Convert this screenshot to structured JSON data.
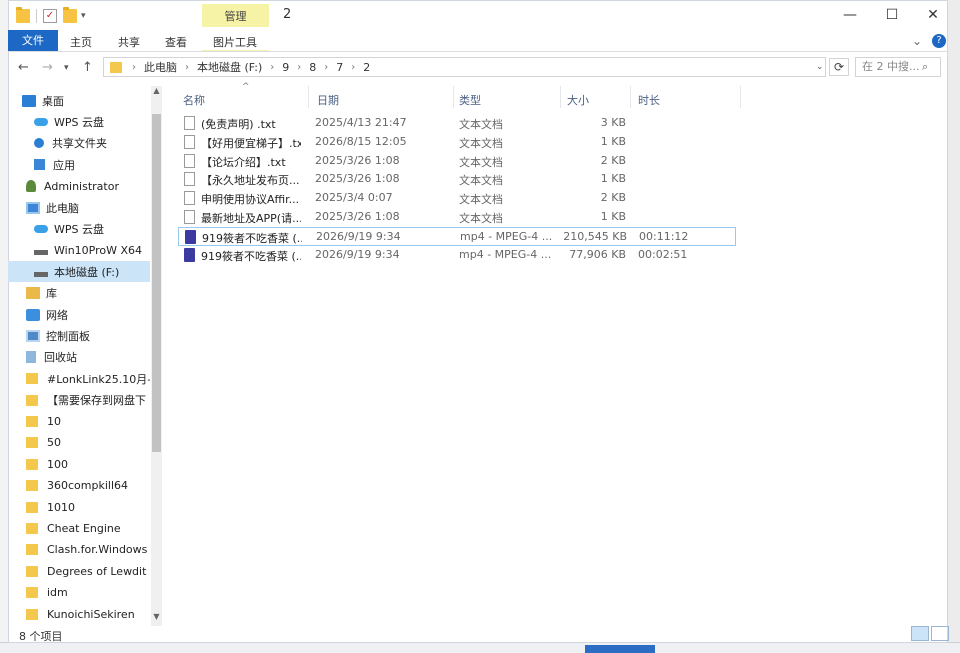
{
  "window": {
    "title": "2",
    "context_tab": "管理",
    "controls": {
      "minimize": "—",
      "maximize": "☐",
      "close": "✕"
    }
  },
  "ribbon": {
    "tabs": [
      "文件",
      "主页",
      "共享",
      "查看",
      "图片工具"
    ],
    "collapse_glyph": "⌄",
    "help_glyph": "?"
  },
  "address": {
    "crumbs": [
      "此电脑",
      "本地磁盘 (F:)",
      "9",
      "8",
      "7",
      "2"
    ],
    "search_placeholder": "在 2 中搜...",
    "refresh_glyph": "⟳"
  },
  "nav": {
    "items": [
      {
        "label": "桌面",
        "icon": "desktop-icon",
        "kind": "desk"
      },
      {
        "label": "WPS 云盘",
        "icon": "cloud-icon",
        "kind": "cloud"
      },
      {
        "label": "共享文件夹",
        "icon": "share-icon",
        "kind": "share"
      },
      {
        "label": "应用",
        "icon": "apps-icon",
        "kind": "app"
      },
      {
        "label": "Administrator",
        "icon": "user-icon",
        "kind": "user"
      },
      {
        "label": "此电脑",
        "icon": "computer-icon",
        "kind": "pc"
      },
      {
        "label": "WPS 云盘",
        "icon": "cloud-icon",
        "kind": "cloud"
      },
      {
        "label": "Win10ProW X64",
        "icon": "drive-icon",
        "kind": "drive"
      },
      {
        "label": "本地磁盘 (F:)",
        "icon": "drive-icon",
        "kind": "drive",
        "selected": true
      },
      {
        "label": "库",
        "icon": "library-icon",
        "kind": "lib"
      },
      {
        "label": "网络",
        "icon": "network-icon",
        "kind": "net"
      },
      {
        "label": "控制面板",
        "icon": "control-panel-icon",
        "kind": "ctrl"
      },
      {
        "label": "回收站",
        "icon": "recycle-bin-icon",
        "kind": "bin"
      },
      {
        "label": "#LonkLink25.10月-",
        "icon": "folder-icon",
        "kind": "fold"
      },
      {
        "label": "【需要保存到网盘下",
        "icon": "folder-icon",
        "kind": "fold"
      },
      {
        "label": "10",
        "icon": "folder-icon",
        "kind": "fold"
      },
      {
        "label": "50",
        "icon": "folder-icon",
        "kind": "fold"
      },
      {
        "label": "100",
        "icon": "folder-icon",
        "kind": "fold"
      },
      {
        "label": "360compkill64",
        "icon": "folder-icon",
        "kind": "fold"
      },
      {
        "label": "1010",
        "icon": "folder-icon",
        "kind": "fold"
      },
      {
        "label": "Cheat Engine",
        "icon": "folder-icon",
        "kind": "fold"
      },
      {
        "label": "Clash.for.Windows",
        "icon": "folder-icon",
        "kind": "fold"
      },
      {
        "label": "Degrees of Lewdit",
        "icon": "folder-icon",
        "kind": "fold"
      },
      {
        "label": "idm",
        "icon": "folder-icon",
        "kind": "fold"
      },
      {
        "label": "KunoichiSekiren",
        "icon": "folder-icon",
        "kind": "fold"
      }
    ]
  },
  "columns": [
    "名称",
    "日期",
    "类型",
    "大小",
    "时长"
  ],
  "files": [
    {
      "name": "(免责声明) .txt",
      "date": "2025/4/13 21:47",
      "type": "文本文档",
      "size": "3 KB",
      "duration": "",
      "kind": "txt"
    },
    {
      "name": "【好用便宜梯子】.txt",
      "date": "2026/8/15 12:05",
      "type": "文本文档",
      "size": "1 KB",
      "duration": "",
      "kind": "txt"
    },
    {
      "name": "【论坛介绍】.txt",
      "date": "2025/3/26 1:08",
      "type": "文本文档",
      "size": "2 KB",
      "duration": "",
      "kind": "txt"
    },
    {
      "name": "【永久地址发布页...",
      "date": "2025/3/26 1:08",
      "type": "文本文档",
      "size": "1 KB",
      "duration": "",
      "kind": "txt"
    },
    {
      "name": "申明使用协议Affir...",
      "date": "2025/3/4 0:07",
      "type": "文本文档",
      "size": "2 KB",
      "duration": "",
      "kind": "txt"
    },
    {
      "name": "最新地址及APP(请...",
      "date": "2025/3/26 1:08",
      "type": "文本文档",
      "size": "1 KB",
      "duration": "",
      "kind": "txt"
    },
    {
      "name": "919筱者不吃香菜 (...",
      "date": "2026/9/19 9:34",
      "type": "mp4 - MPEG-4 ...",
      "size": "210,545 KB",
      "duration": "00:11:12",
      "kind": "mp4",
      "selected": true
    },
    {
      "name": "919筱者不吃香菜 (...",
      "date": "2026/9/19 9:34",
      "type": "mp4 - MPEG-4 ...",
      "size": "77,906 KB",
      "duration": "00:02:51",
      "kind": "mp4"
    }
  ],
  "status": {
    "count": "8 个项目"
  }
}
